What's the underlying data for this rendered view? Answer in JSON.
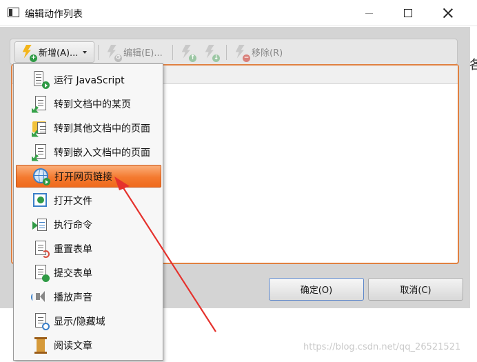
{
  "window": {
    "title": "编辑动作列表"
  },
  "toolbar": {
    "add_label": "新增(A)...",
    "edit_label": "编辑(E)...",
    "remove_label": "移除(R)"
  },
  "menu": {
    "items": [
      {
        "label": "运行 JavaScript",
        "icon": "javascript-icon"
      },
      {
        "label": "转到文档中的某页",
        "icon": "goto-page-icon"
      },
      {
        "label": "转到其他文档中的页面",
        "icon": "goto-other-document-icon"
      },
      {
        "label": "转到嵌入文档中的页面",
        "icon": "goto-embedded-document-icon"
      },
      {
        "label": "打开网页链接",
        "icon": "globe-icon",
        "selected": true
      },
      {
        "label": "打开文件",
        "icon": "open-file-icon"
      },
      {
        "label": "执行命令",
        "icon": "command-icon"
      },
      {
        "label": "重置表单",
        "icon": "reset-form-icon"
      },
      {
        "label": "提交表单",
        "icon": "submit-form-icon"
      },
      {
        "label": "播放声音",
        "icon": "speaker-icon"
      },
      {
        "label": "显示/隐藏域",
        "icon": "show-hide-field-icon"
      },
      {
        "label": "阅读文章",
        "icon": "read-article-icon"
      }
    ]
  },
  "buttons": {
    "ok": "确定(O)",
    "cancel": "取消(C)"
  },
  "background": {
    "stray_char": "各"
  },
  "watermark": "https://blog.csdn.net/qq_26521521",
  "colors": {
    "accent": "#f47a30",
    "selection_border": "#c8571b",
    "list_border": "#e08040",
    "annotation_arrow": "#e5322d"
  }
}
